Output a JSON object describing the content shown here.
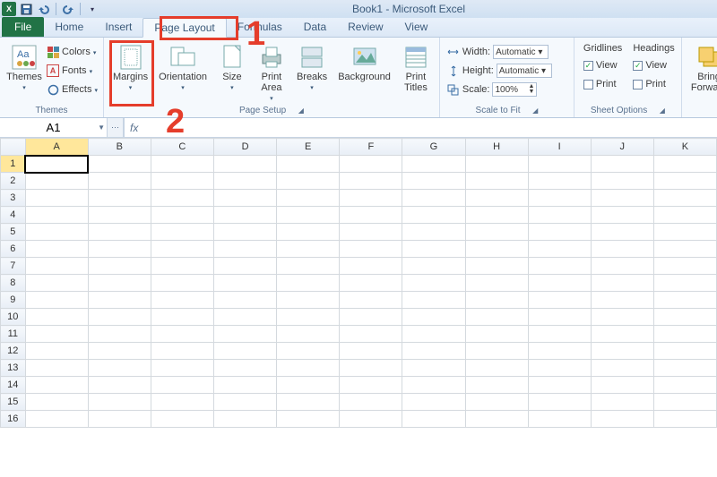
{
  "titlebar": {
    "title": "Book1 - Microsoft Excel"
  },
  "qat": {
    "save_tip": "Save",
    "undo_tip": "Undo",
    "redo_tip": "Redo"
  },
  "tabs": {
    "file": "File",
    "items": [
      "Home",
      "Insert",
      "Page Layout",
      "Formulas",
      "Data",
      "Review",
      "View"
    ],
    "active_index": 2
  },
  "ribbon": {
    "themes": {
      "label": "Themes",
      "themes_btn": "Themes",
      "colors": "Colors",
      "fonts": "Fonts",
      "effects": "Effects"
    },
    "page_setup": {
      "label": "Page Setup",
      "margins": "Margins",
      "orientation": "Orientation",
      "size": "Size",
      "print_area": "Print\nArea",
      "breaks": "Breaks",
      "background": "Background",
      "print_titles": "Print\nTitles"
    },
    "scale": {
      "label": "Scale to Fit",
      "width": "Width:",
      "height": "Height:",
      "scale": "Scale:",
      "width_val": "Automatic",
      "height_val": "Automatic",
      "scale_val": "100%"
    },
    "sheet_options": {
      "label": "Sheet Options",
      "gridlines": "Gridlines",
      "headings": "Headings",
      "view": "View",
      "print": "Print"
    },
    "arrange": {
      "bring_forward": "Bring\nForward"
    }
  },
  "annotations": {
    "one": "1",
    "two": "2"
  },
  "namebox": {
    "value": "A1"
  },
  "formulabar": {
    "fx": "fx",
    "value": ""
  },
  "grid": {
    "cols": [
      "A",
      "B",
      "C",
      "D",
      "E",
      "F",
      "G",
      "H",
      "I",
      "J",
      "K"
    ],
    "rows": [
      "1",
      "2",
      "3",
      "4",
      "5",
      "6",
      "7",
      "8",
      "9",
      "10",
      "11",
      "12",
      "13",
      "14",
      "15",
      "16"
    ],
    "selected_col_index": 0,
    "selected_row_index": 0
  }
}
